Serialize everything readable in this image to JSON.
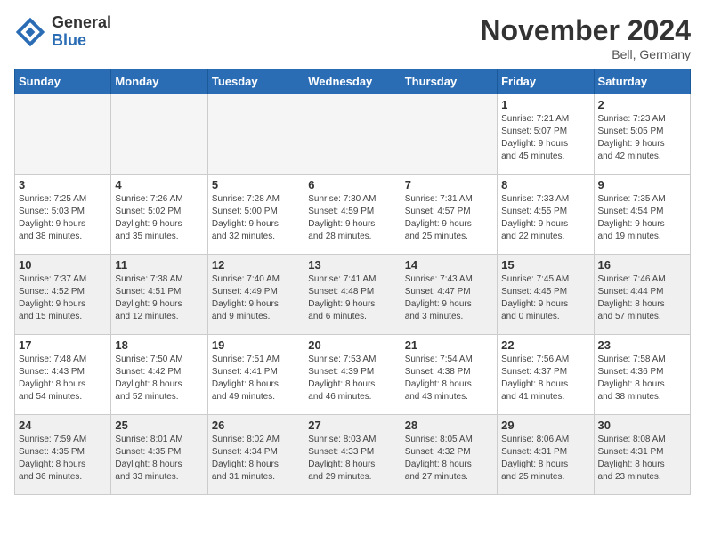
{
  "header": {
    "logo_general": "General",
    "logo_blue": "Blue",
    "month_title": "November 2024",
    "location": "Bell, Germany"
  },
  "days_of_week": [
    "Sunday",
    "Monday",
    "Tuesday",
    "Wednesday",
    "Thursday",
    "Friday",
    "Saturday"
  ],
  "weeks": [
    [
      {
        "day": "",
        "info": "",
        "empty": true
      },
      {
        "day": "",
        "info": "",
        "empty": true
      },
      {
        "day": "",
        "info": "",
        "empty": true
      },
      {
        "day": "",
        "info": "",
        "empty": true
      },
      {
        "day": "",
        "info": "",
        "empty": true
      },
      {
        "day": "1",
        "info": "Sunrise: 7:21 AM\nSunset: 5:07 PM\nDaylight: 9 hours\nand 45 minutes."
      },
      {
        "day": "2",
        "info": "Sunrise: 7:23 AM\nSunset: 5:05 PM\nDaylight: 9 hours\nand 42 minutes."
      }
    ],
    [
      {
        "day": "3",
        "info": "Sunrise: 7:25 AM\nSunset: 5:03 PM\nDaylight: 9 hours\nand 38 minutes."
      },
      {
        "day": "4",
        "info": "Sunrise: 7:26 AM\nSunset: 5:02 PM\nDaylight: 9 hours\nand 35 minutes."
      },
      {
        "day": "5",
        "info": "Sunrise: 7:28 AM\nSunset: 5:00 PM\nDaylight: 9 hours\nand 32 minutes."
      },
      {
        "day": "6",
        "info": "Sunrise: 7:30 AM\nSunset: 4:59 PM\nDaylight: 9 hours\nand 28 minutes."
      },
      {
        "day": "7",
        "info": "Sunrise: 7:31 AM\nSunset: 4:57 PM\nDaylight: 9 hours\nand 25 minutes."
      },
      {
        "day": "8",
        "info": "Sunrise: 7:33 AM\nSunset: 4:55 PM\nDaylight: 9 hours\nand 22 minutes."
      },
      {
        "day": "9",
        "info": "Sunrise: 7:35 AM\nSunset: 4:54 PM\nDaylight: 9 hours\nand 19 minutes."
      }
    ],
    [
      {
        "day": "10",
        "info": "Sunrise: 7:37 AM\nSunset: 4:52 PM\nDaylight: 9 hours\nand 15 minutes.",
        "shaded": true
      },
      {
        "day": "11",
        "info": "Sunrise: 7:38 AM\nSunset: 4:51 PM\nDaylight: 9 hours\nand 12 minutes.",
        "shaded": true
      },
      {
        "day": "12",
        "info": "Sunrise: 7:40 AM\nSunset: 4:49 PM\nDaylight: 9 hours\nand 9 minutes.",
        "shaded": true
      },
      {
        "day": "13",
        "info": "Sunrise: 7:41 AM\nSunset: 4:48 PM\nDaylight: 9 hours\nand 6 minutes.",
        "shaded": true
      },
      {
        "day": "14",
        "info": "Sunrise: 7:43 AM\nSunset: 4:47 PM\nDaylight: 9 hours\nand 3 minutes.",
        "shaded": true
      },
      {
        "day": "15",
        "info": "Sunrise: 7:45 AM\nSunset: 4:45 PM\nDaylight: 9 hours\nand 0 minutes.",
        "shaded": true
      },
      {
        "day": "16",
        "info": "Sunrise: 7:46 AM\nSunset: 4:44 PM\nDaylight: 8 hours\nand 57 minutes.",
        "shaded": true
      }
    ],
    [
      {
        "day": "17",
        "info": "Sunrise: 7:48 AM\nSunset: 4:43 PM\nDaylight: 8 hours\nand 54 minutes."
      },
      {
        "day": "18",
        "info": "Sunrise: 7:50 AM\nSunset: 4:42 PM\nDaylight: 8 hours\nand 52 minutes."
      },
      {
        "day": "19",
        "info": "Sunrise: 7:51 AM\nSunset: 4:41 PM\nDaylight: 8 hours\nand 49 minutes."
      },
      {
        "day": "20",
        "info": "Sunrise: 7:53 AM\nSunset: 4:39 PM\nDaylight: 8 hours\nand 46 minutes."
      },
      {
        "day": "21",
        "info": "Sunrise: 7:54 AM\nSunset: 4:38 PM\nDaylight: 8 hours\nand 43 minutes."
      },
      {
        "day": "22",
        "info": "Sunrise: 7:56 AM\nSunset: 4:37 PM\nDaylight: 8 hours\nand 41 minutes."
      },
      {
        "day": "23",
        "info": "Sunrise: 7:58 AM\nSunset: 4:36 PM\nDaylight: 8 hours\nand 38 minutes."
      }
    ],
    [
      {
        "day": "24",
        "info": "Sunrise: 7:59 AM\nSunset: 4:35 PM\nDaylight: 8 hours\nand 36 minutes.",
        "shaded": true
      },
      {
        "day": "25",
        "info": "Sunrise: 8:01 AM\nSunset: 4:35 PM\nDaylight: 8 hours\nand 33 minutes.",
        "shaded": true
      },
      {
        "day": "26",
        "info": "Sunrise: 8:02 AM\nSunset: 4:34 PM\nDaylight: 8 hours\nand 31 minutes.",
        "shaded": true
      },
      {
        "day": "27",
        "info": "Sunrise: 8:03 AM\nSunset: 4:33 PM\nDaylight: 8 hours\nand 29 minutes.",
        "shaded": true
      },
      {
        "day": "28",
        "info": "Sunrise: 8:05 AM\nSunset: 4:32 PM\nDaylight: 8 hours\nand 27 minutes.",
        "shaded": true
      },
      {
        "day": "29",
        "info": "Sunrise: 8:06 AM\nSunset: 4:31 PM\nDaylight: 8 hours\nand 25 minutes.",
        "shaded": true
      },
      {
        "day": "30",
        "info": "Sunrise: 8:08 AM\nSunset: 4:31 PM\nDaylight: 8 hours\nand 23 minutes.",
        "shaded": true
      }
    ]
  ]
}
